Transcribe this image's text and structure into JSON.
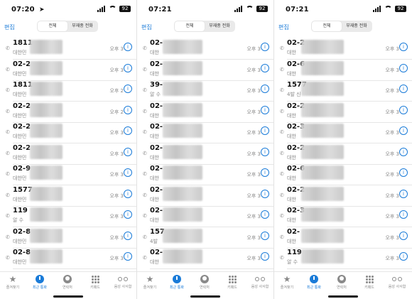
{
  "screens": [
    {
      "status": {
        "time": "07:20",
        "battery": "92"
      },
      "nav": {
        "edit": "편집",
        "seg_all": "전체",
        "seg_missed": "부재중 전화"
      },
      "rows": [
        {
          "number": "1811",
          "sub": "대한민",
          "time": "오후 3"
        },
        {
          "number": "02-2",
          "sub": "대한민",
          "time": "오후 3"
        },
        {
          "number": "1811",
          "sub": "대한민",
          "time": "오후 2"
        },
        {
          "number": "02-2",
          "sub": "대한민",
          "time": "오후 2"
        },
        {
          "number": "02-2",
          "sub": "대한민",
          "time": "오후 3"
        },
        {
          "number": "02-2",
          "sub": "대한민",
          "time": "오후 3"
        },
        {
          "number": "02-9",
          "sub": "대한민",
          "time": "오후 3"
        },
        {
          "number": "1577",
          "sub": "대한민",
          "time": "오후 3"
        },
        {
          "number": "119",
          "sub": "알 수",
          "time": "오후 3"
        },
        {
          "number": "02-8",
          "sub": "대한민",
          "time": "오후 3"
        },
        {
          "number": "02-8",
          "sub": "대한민",
          "time": "오후 3"
        }
      ],
      "tabbar": {
        "favorites": "즐겨찾기",
        "recents": "최근 통화",
        "contacts": "연락처",
        "keypad": "키패드",
        "voicemail": "음성 사서함"
      }
    },
    {
      "status": {
        "time": "07:21",
        "battery": "92"
      },
      "nav": {
        "edit": "편집",
        "seg_all": "전체",
        "seg_missed": "부재중 전화"
      },
      "rows": [
        {
          "number": "02-",
          "sub": "대한",
          "time": "오후 3"
        },
        {
          "number": "02-",
          "sub": "대한",
          "time": "오후 3"
        },
        {
          "number": "39-",
          "sub": "알 수",
          "time": "오후 3"
        },
        {
          "number": "02-",
          "sub": "대한",
          "time": "오후 3"
        },
        {
          "number": "02-",
          "sub": "대한",
          "time": "오후 3"
        },
        {
          "number": "02-",
          "sub": "대한",
          "time": "오후 3"
        },
        {
          "number": "02-",
          "sub": "대한",
          "time": "오후 3"
        },
        {
          "number": "02-",
          "sub": "대한",
          "time": "오후 3"
        },
        {
          "number": "02-",
          "sub": "대한",
          "time": "오후 3"
        },
        {
          "number": "157",
          "sub": "4발",
          "time": "오후 3"
        },
        {
          "number": "02-",
          "sub": "대한",
          "time": "오후 3"
        }
      ],
      "tabbar": {
        "favorites": "즐겨찾기",
        "recents": "최근 통화",
        "contacts": "연락처",
        "keypad": "키패드",
        "voicemail": "음성 사서함"
      }
    },
    {
      "status": {
        "time": "07:21",
        "battery": "92"
      },
      "nav": {
        "edit": "편집",
        "seg_all": "전체",
        "seg_missed": "부재중 전화"
      },
      "rows": [
        {
          "number": "02-2",
          "sub": "대한",
          "time": "오후 3"
        },
        {
          "number": "02-6",
          "sub": "대한",
          "time": "오후 3"
        },
        {
          "number": "1577",
          "sub": "4발 신",
          "time": "오후 3"
        },
        {
          "number": "02-2",
          "sub": "대한",
          "time": "오후 3"
        },
        {
          "number": "02-3",
          "sub": "대한",
          "time": "오후 3"
        },
        {
          "number": "02-2",
          "sub": "대한",
          "time": "오후 3"
        },
        {
          "number": "02-6",
          "sub": "대한",
          "time": "오후 3"
        },
        {
          "number": "02-2",
          "sub": "대한",
          "time": "오후 3"
        },
        {
          "number": "02-3",
          "sub": "대한",
          "time": "오후 3"
        },
        {
          "number": "02-",
          "sub": "대한",
          "time": "오후 3"
        },
        {
          "number": "119",
          "sub": "알 수",
          "time": "오후 3"
        }
      ],
      "tabbar": {
        "favorites": "즐겨찾기",
        "recents": "최근 통화",
        "contacts": "연락처",
        "keypad": "키패드",
        "voicemail": "음성 사서함"
      }
    }
  ],
  "colors": {
    "accent": "#1a7bd8",
    "muted": "#888888",
    "separator": "#e6e6e6"
  },
  "icons": [
    "location-arrow-icon",
    "signal-icon",
    "wifi-icon",
    "battery-icon",
    "phone-icon",
    "info-icon",
    "star-icon",
    "clock-icon",
    "person-icon",
    "keypad-icon",
    "voicemail-icon"
  ]
}
